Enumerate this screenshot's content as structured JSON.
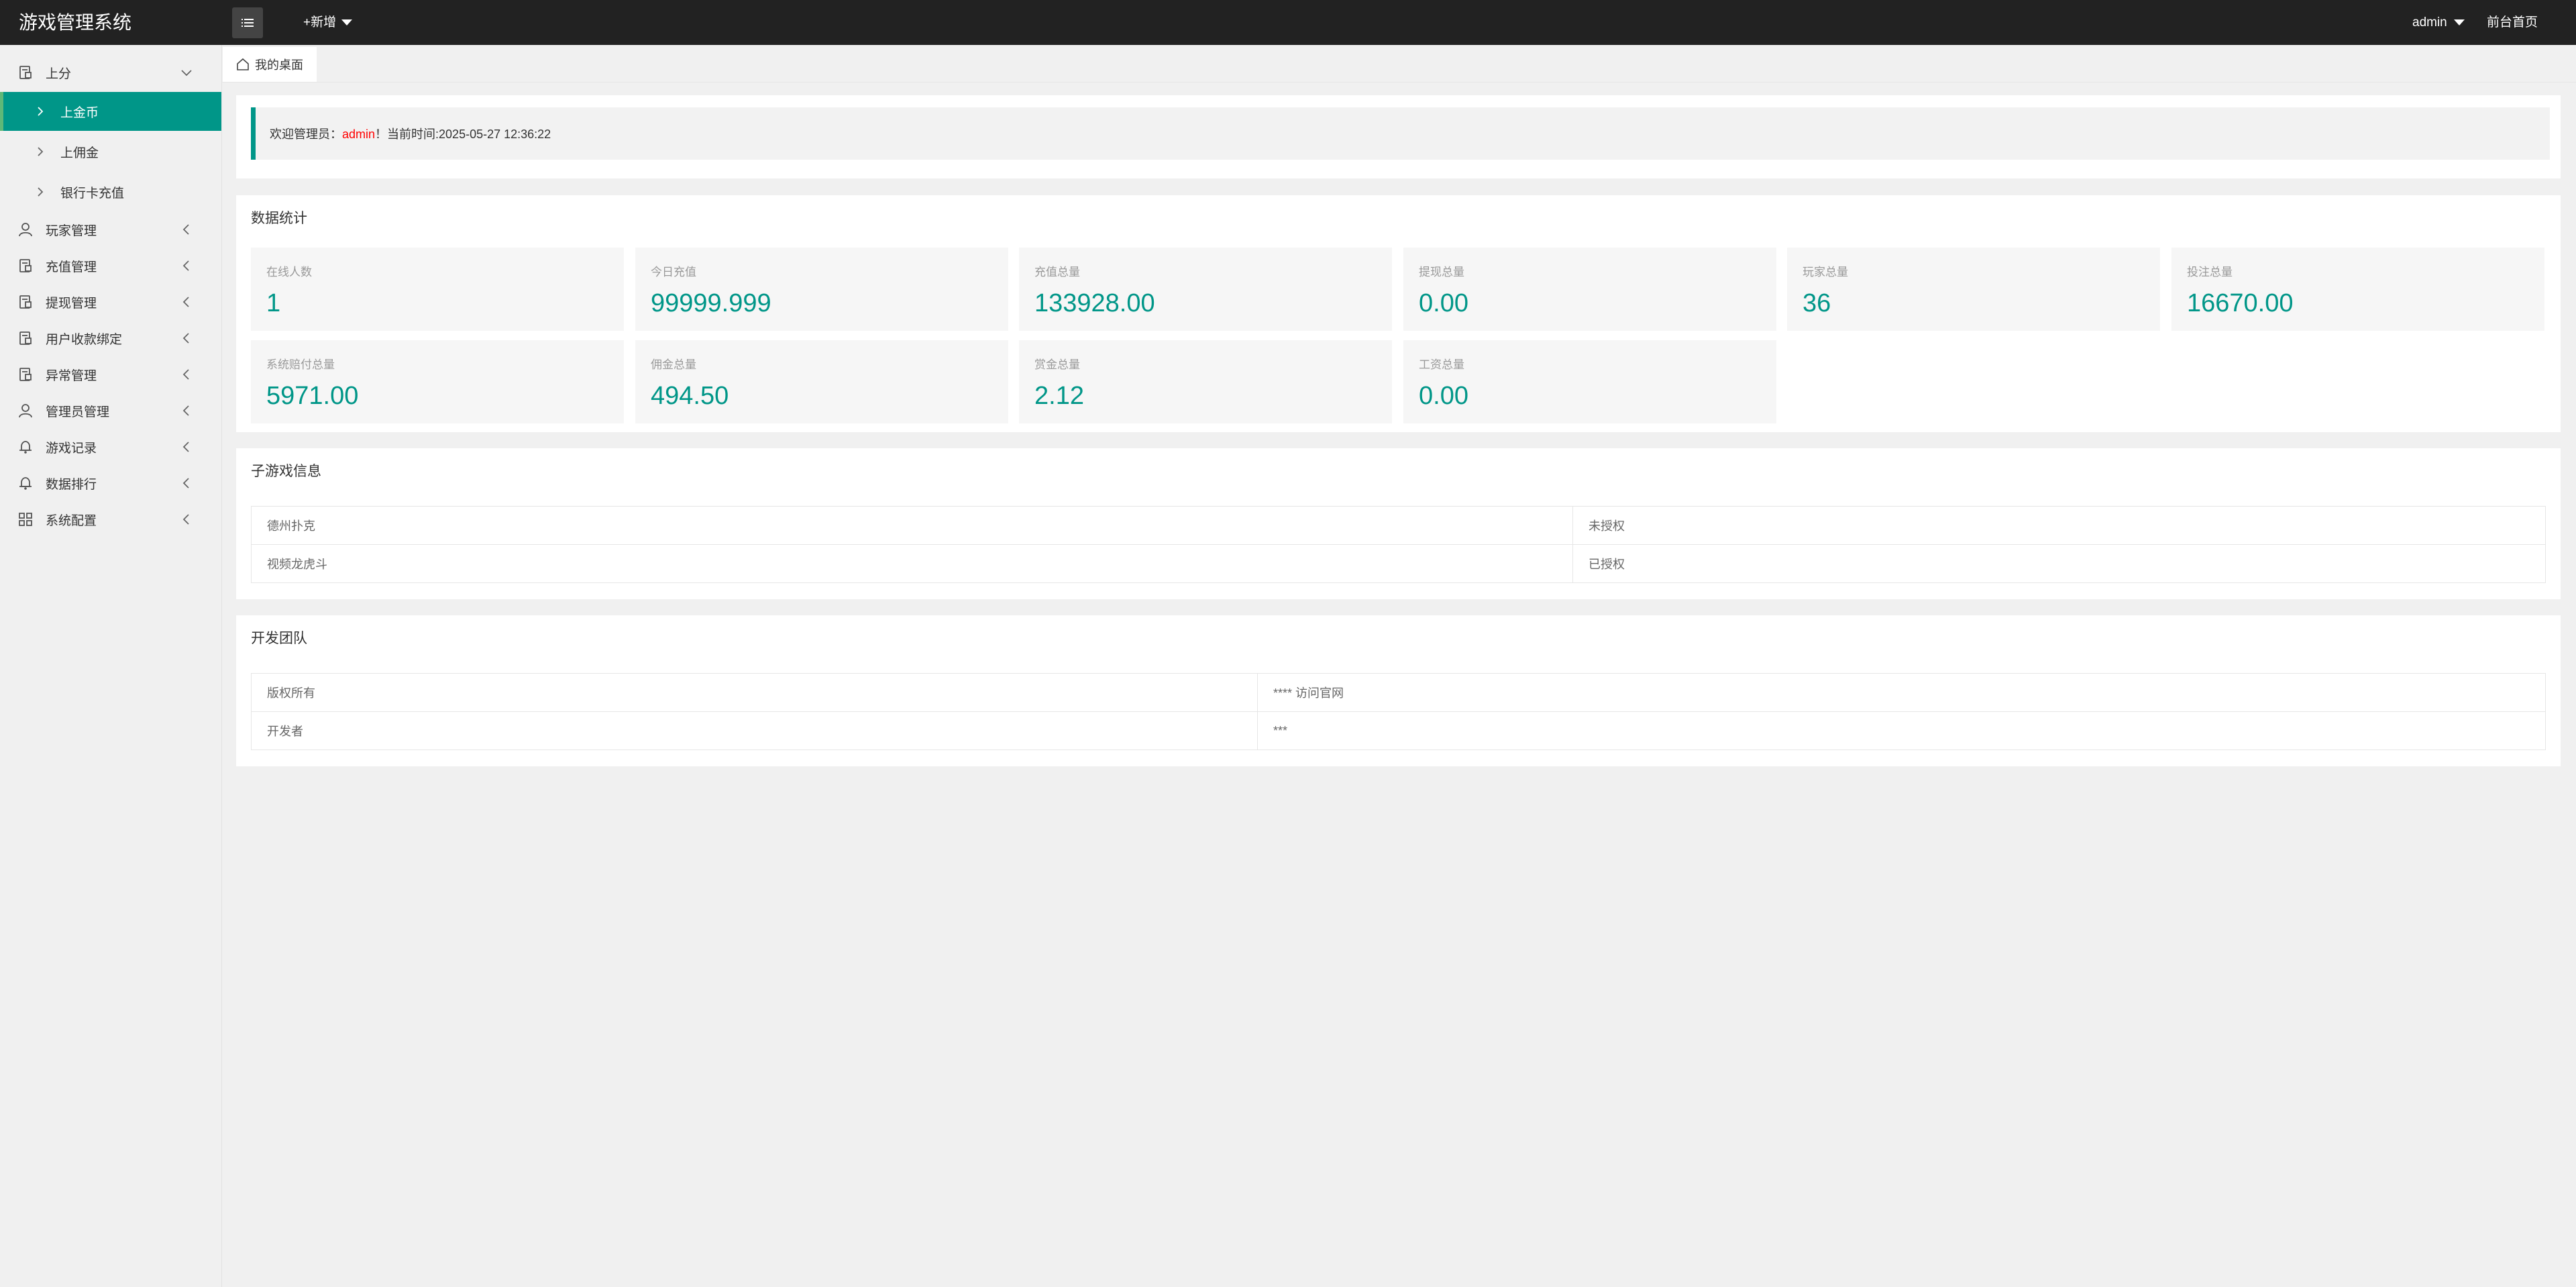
{
  "app": {
    "title": "游戏管理系统"
  },
  "topbar": {
    "add_new": "+新增",
    "user": "admin",
    "front_link": "前台首页"
  },
  "sidebar": {
    "groups": [
      {
        "label": "上分",
        "icon": "document-icon",
        "expanded": true,
        "children": [
          {
            "label": "上金币",
            "active": true
          },
          {
            "label": "上佣金"
          },
          {
            "label": "银行卡充值"
          }
        ]
      },
      {
        "label": "玩家管理",
        "icon": "user-icon"
      },
      {
        "label": "充值管理",
        "icon": "document-icon"
      },
      {
        "label": "提现管理",
        "icon": "document-icon"
      },
      {
        "label": "用户收款绑定",
        "icon": "document-icon"
      },
      {
        "label": "异常管理",
        "icon": "document-icon"
      },
      {
        "label": "管理员管理",
        "icon": "user-icon"
      },
      {
        "label": "游戏记录",
        "icon": "bell-icon"
      },
      {
        "label": "数据排行",
        "icon": "bell-icon"
      },
      {
        "label": "系统配置",
        "icon": "grid-icon"
      }
    ]
  },
  "tabs": [
    {
      "label": "我的桌面",
      "icon": "home-icon"
    }
  ],
  "welcome": {
    "prefix": "欢迎管理员：",
    "name": "admin",
    "suffix": "！当前时间:2025-05-27 12:36:22"
  },
  "stats": {
    "title": "数据统计",
    "items": [
      {
        "label": "在线人数",
        "value": "1"
      },
      {
        "label": "今日充值",
        "value": "99999.999"
      },
      {
        "label": "充值总量",
        "value": "133928.00"
      },
      {
        "label": "提现总量",
        "value": "0.00"
      },
      {
        "label": "玩家总量",
        "value": "36"
      },
      {
        "label": "投注总量",
        "value": "16670.00"
      },
      {
        "label": "系统赔付总量",
        "value": "5971.00"
      },
      {
        "label": "佣金总量",
        "value": "494.50"
      },
      {
        "label": "赏金总量",
        "value": "2.12"
      },
      {
        "label": "工资总量",
        "value": "0.00"
      }
    ]
  },
  "games": {
    "title": "子游戏信息",
    "rows": [
      {
        "name": "德州扑克",
        "status": "未授权"
      },
      {
        "name": "视频龙虎斗",
        "status": "已授权"
      }
    ]
  },
  "team": {
    "title": "开发团队",
    "rows": [
      {
        "key": "版权所有",
        "value": "**** 访问官网"
      },
      {
        "key": "开发者",
        "value": "***"
      }
    ]
  },
  "colors": {
    "accent": "#009688",
    "topbar": "#222222",
    "highlight_name": "#ff0000"
  }
}
